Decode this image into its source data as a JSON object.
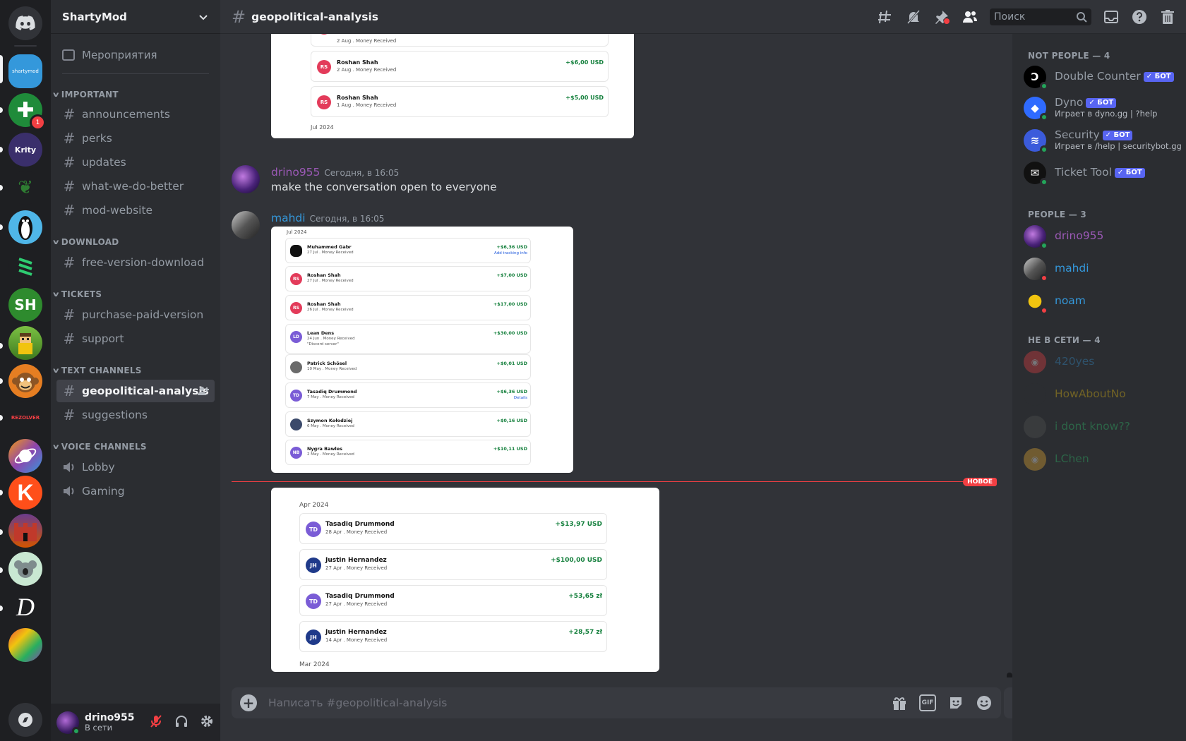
{
  "server": {
    "name": "ShartyMod"
  },
  "rail": {
    "badge_count": "1",
    "servers": [
      "Discord",
      "ShartyMod",
      "Add",
      "Krity",
      "Tree",
      "Penguin",
      "Stripes",
      "SH",
      "Pixel",
      "Monkey",
      "Rezolver",
      "Orbit",
      "K",
      "Castle",
      "Koala",
      "D",
      "Colorful"
    ],
    "sh_label": "SH",
    "k_label": "K",
    "d_label": "D",
    "krity_label": "Krity"
  },
  "sidebar": {
    "events_label": "Мероприятия",
    "categories": {
      "important": "IMPORTANT",
      "download": "DOWNLOAD",
      "tickets": "TICKETS",
      "text": "TEXT CHANNELS",
      "voice": "VOICE CHANNELS"
    },
    "channels": {
      "announcements": "announcements",
      "perks": "perks",
      "updates": "updates",
      "what_we_do_better": "what-we-do-better",
      "mod_website": "mod-website",
      "free_version_download": "free-version-download",
      "purchase_paid_version": "purchase-paid-version",
      "support": "support",
      "geopolitical_analysis": "geopolitical-analysis",
      "suggestions": "suggestions",
      "lobby": "Lobby",
      "gaming": "Gaming"
    }
  },
  "user": {
    "name": "drino955",
    "status": "В сети"
  },
  "topbar": {
    "channel": "geopolitical-analysis",
    "search_placeholder": "Поиск"
  },
  "messages": [
    {
      "author": "drino955",
      "author_color": "#9b59b6",
      "time": "Сегодня, в 16:05",
      "text": "make the conversation open to everyone"
    },
    {
      "author": "mahdi",
      "author_color": "#3498db",
      "time": "Сегодня, в 16:05"
    }
  ],
  "new_marker": "НОВОЕ",
  "card1": {
    "rows": [
      {
        "sub": "2 Aug . Money Received"
      },
      {
        "name": "Roshan Shah",
        "sub": "2 Aug . Money Received",
        "amount": "+$6,00 USD",
        "initials": "RS"
      },
      {
        "name": "Roshan Shah",
        "sub": "1 Aug . Money Received",
        "amount": "+$5,00 USD",
        "initials": "RS"
      }
    ],
    "month": "Jul 2024"
  },
  "card2": {
    "month": "Jul 2024",
    "rows": [
      {
        "name": "Muhammed Gabr",
        "sub": "27 Jul . Money Received",
        "amount": "+$6,36 USD",
        "link": "Add tracking info",
        "initials": ""
      },
      {
        "name": "Roshan Shah",
        "sub": "27 Jul . Money Received",
        "amount": "+$7,00 USD",
        "initials": "RS"
      },
      {
        "name": "Roshan Shah",
        "sub": "26 Jul . Money Received",
        "amount": "+$17,00 USD",
        "initials": "RS"
      },
      {
        "name": "Lean Dens",
        "sub": "24 Jun . Money Received",
        "note": "\"Discord server\"",
        "amount": "+$30,00 USD",
        "initials": "LD"
      },
      {
        "name": "Patrick Schösel",
        "sub": "10 May . Money Received",
        "amount": "+$0,01 USD",
        "initials": ""
      },
      {
        "name": "Tasadiq Drummond",
        "sub": "7 May . Money Received",
        "amount": "+$6,36 USD",
        "link": "Details",
        "initials": "TD"
      },
      {
        "name": "Szymon Kołodziej",
        "sub": "6 May . Money Received",
        "amount": "+$0,16 USD",
        "initials": ""
      },
      {
        "name": "Nygra Bawles",
        "sub": "2 May . Money Received",
        "amount": "+$10,11 USD",
        "initials": "NB"
      }
    ]
  },
  "card3": {
    "month_top": "Apr 2024",
    "month_bottom": "Mar 2024",
    "rows": [
      {
        "name": "Tasadiq Drummond",
        "sub": "28 Apr . Money Received",
        "amount": "+$13,97 USD",
        "initials": "TD"
      },
      {
        "name": "Justin Hernandez",
        "sub": "27 Apr . Money Received",
        "amount": "+$100,00 USD",
        "initials": "JH"
      },
      {
        "name": "Tasadiq Drummond",
        "sub": "27 Apr . Money Received",
        "amount": "+53,65 zł",
        "initials": "TD"
      },
      {
        "name": "Justin Hernandez",
        "sub": "14 Apr . Money Received",
        "amount": "+28,57 zł",
        "initials": "JH"
      }
    ]
  },
  "composer": {
    "placeholder": "Написать #geopolitical-analysis",
    "gif_label": "GIF"
  },
  "members": {
    "groups": {
      "not_people": "NOT PEOPLE — 4",
      "people": "PEOPLE — 3",
      "offline": "НЕ В СЕТИ — 4"
    },
    "bot_tag": "БОТ",
    "bots": [
      {
        "name": "Double Counter",
        "activity": ""
      },
      {
        "name": "Dyno",
        "activity": "Играет в dyno.gg | ?help"
      },
      {
        "name": "Security",
        "activity": "Играет в /help | securitybot.gg"
      },
      {
        "name": "Ticket Tool",
        "activity": ""
      }
    ],
    "people": [
      {
        "name": "drino955",
        "color": "#9b59b6"
      },
      {
        "name": "mahdi",
        "color": "#3498db"
      },
      {
        "name": "noam",
        "color": "#3498db"
      }
    ],
    "offline": [
      {
        "name": "420yes",
        "color": "#3498db"
      },
      {
        "name": "HowAboutNo",
        "color": "#f1c40f"
      },
      {
        "name": "i dont know??",
        "color": "#2ecc71"
      },
      {
        "name": "LChen",
        "color": "#2ecc71"
      }
    ]
  },
  "colors": {
    "accent": "#5865f2",
    "online": "#23a55a",
    "dnd": "#f23f43",
    "new_marker": "#f23f43"
  }
}
